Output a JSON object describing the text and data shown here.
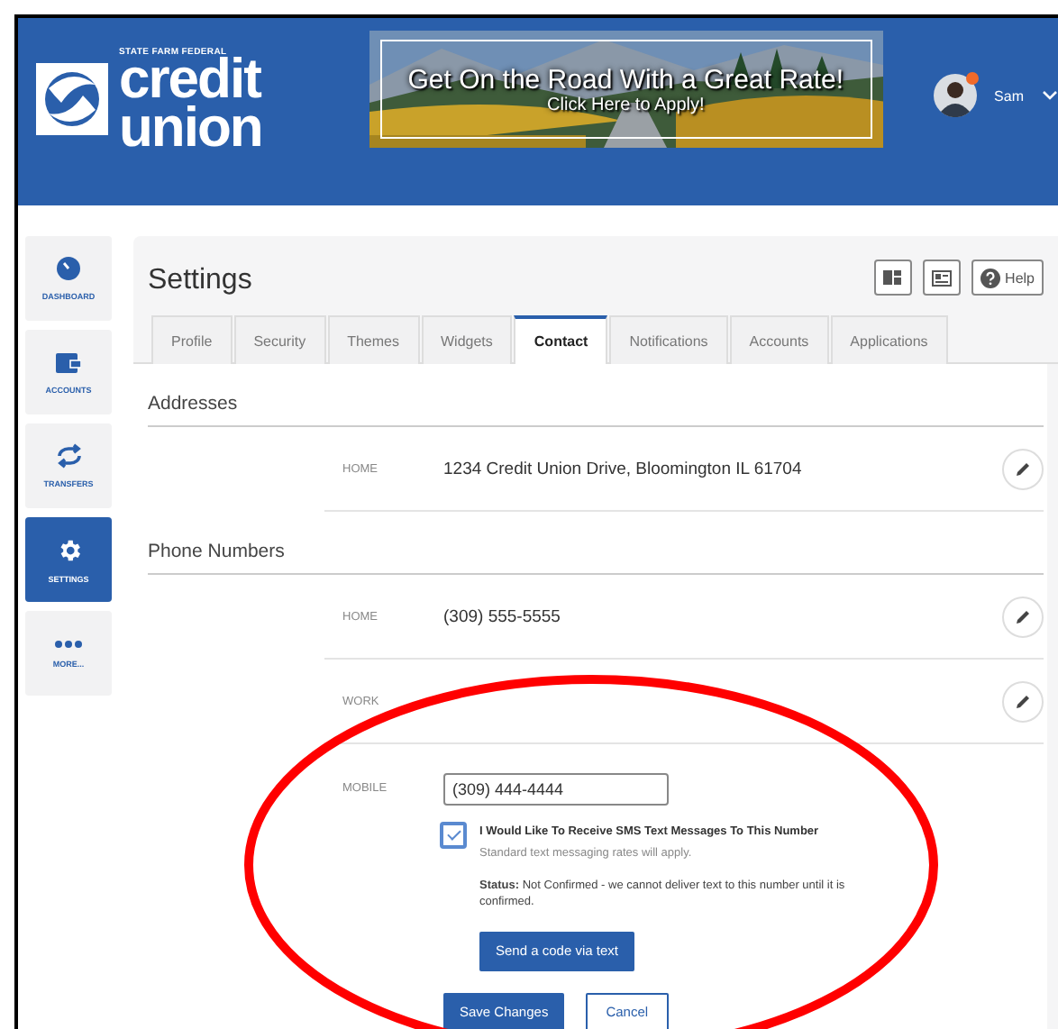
{
  "header": {
    "logo": {
      "tagline": "STATE FARM FEDERAL",
      "line1": "credit",
      "line2": "union"
    },
    "banner": {
      "headline": "Get On the Road With a Great Rate!",
      "subline": "Click Here to Apply!"
    },
    "user": {
      "name": "Sam",
      "notification": true
    }
  },
  "sidebar": {
    "items": [
      {
        "kind": "dashboard",
        "label": "DASHBOARD",
        "selected": false
      },
      {
        "kind": "accounts",
        "label": "ACCOUNTS",
        "selected": false
      },
      {
        "kind": "transfers",
        "label": "TRANSFERS",
        "selected": false
      },
      {
        "kind": "settings",
        "label": "SETTINGS",
        "selected": true
      },
      {
        "kind": "more",
        "label": "MORE...",
        "selected": false
      }
    ]
  },
  "page": {
    "title": "Settings",
    "toolbar": [
      {
        "kind": "layout"
      },
      {
        "kind": "card"
      },
      {
        "kind": "help",
        "label": "Help"
      }
    ]
  },
  "tabs": [
    {
      "label": "Profile",
      "selected": false
    },
    {
      "label": "Security",
      "selected": false
    },
    {
      "label": "Themes",
      "selected": false
    },
    {
      "label": "Widgets",
      "selected": false
    },
    {
      "label": "Contact",
      "selected": true
    },
    {
      "label": "Notifications",
      "selected": false
    },
    {
      "label": "Accounts",
      "selected": false
    },
    {
      "label": "Applications",
      "selected": false
    }
  ],
  "sections": [
    {
      "title": "Addresses",
      "rows": [
        {
          "kind": "display",
          "label": "HOME",
          "value": "1234 Credit Union Drive, Bloomington IL 61704"
        }
      ]
    },
    {
      "title": "Phone Numbers",
      "rows": [
        {
          "kind": "display",
          "label": "HOME",
          "value": "(309) 555-5555"
        },
        {
          "kind": "display",
          "label": "WORK"
        },
        {
          "kind": "form",
          "label": "MOBILE",
          "value": "(309) 444-4444",
          "sms_checked": true,
          "sms_label": "I Would Like To Receive SMS Text Messages To This Number",
          "sms_note": "Standard text messaging rates will apply.",
          "status": "**Status:** Not Confirmed - we cannot deliver text to this number until it is confirmed.",
          "send_button": "Send a code via text",
          "save_button": "Save Changes",
          "cancel_button": "Cancel"
        }
      ]
    }
  ],
  "annotation": {
    "kind": "ellipse"
  }
}
